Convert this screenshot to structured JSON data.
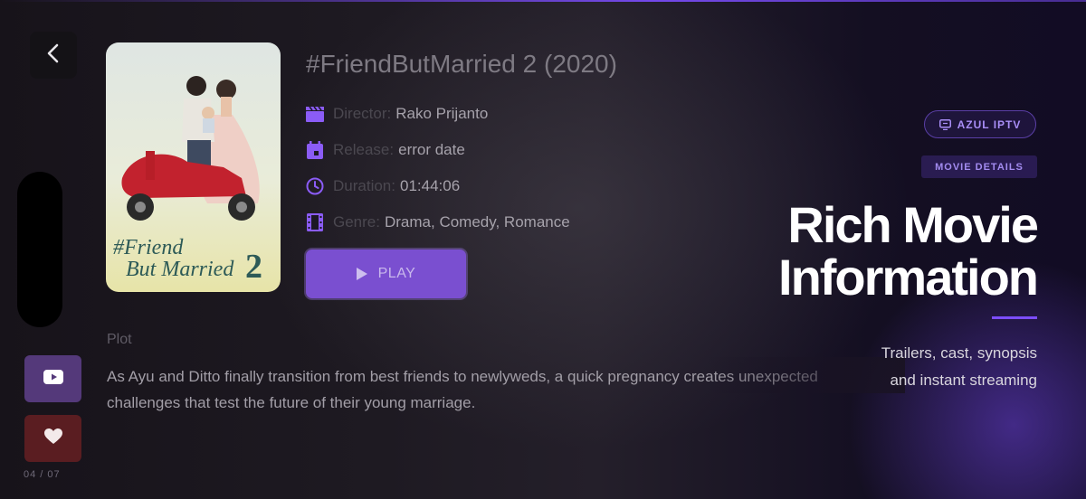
{
  "movie": {
    "title": "#FriendButMarried 2 (2020)",
    "poster_alt_title_line1": "#Friend",
    "poster_alt_title_line2": "But Married",
    "poster_number": "2",
    "director_label": "Director:",
    "director": "Rako Prijanto",
    "release_label": "Release:",
    "release": "error date",
    "duration_label": "Duration:",
    "duration": "01:44:06",
    "genre_label": "Genre:",
    "genre": "Drama, Comedy, Romance",
    "play_label": "PLAY",
    "plot_heading": "Plot",
    "plot": "As Ayu and Ditto finally transition from best friends to newlyweds, a quick pregnancy creates unexpected challenges that test the future of their young marriage."
  },
  "sidebar": {
    "page_indicator": "04 / 07"
  },
  "promo": {
    "brand_badge": "AZUL IPTV",
    "section_badge": "MOVIE DETAILS",
    "headline_line1": "Rich Movie",
    "headline_line2": "Information",
    "subline_line1": "Trailers, cast, synopsis",
    "subline_line2": "and instant streaming"
  },
  "icons": {
    "back": "chevron-left-icon",
    "director": "clapperboard-icon",
    "release": "calendar-icon",
    "duration": "clock-icon",
    "genre": "film-icon",
    "play": "play-icon",
    "trailer": "youtube-icon",
    "favorite": "heart-icon",
    "brand": "tv-icon"
  },
  "colors": {
    "accent": "#7c4dff",
    "play_button": "#7a4fd0",
    "trailer_button": "#54397a",
    "favorite_button": "#5a1d21",
    "icon_purple": "#8b5cf6"
  }
}
